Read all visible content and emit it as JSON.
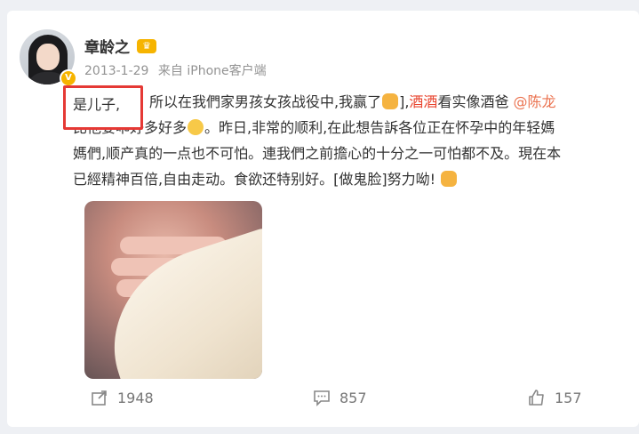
{
  "user": {
    "name": "章龄之",
    "badge_icon": "crown-icon",
    "verified_icon": "verified-v-icon"
  },
  "meta": {
    "date": "2013-1-29",
    "source": "来自 iPhone客户端"
  },
  "post": {
    "highlight": "是儿子,",
    "line1_a": "所以在我們家男孩女孩战役中,我赢了",
    "line1_b": "],",
    "line1_mention_red": "酒酒",
    "line1_c": "看实像酒爸",
    "line1_mention": "@陈龙",
    "line2_a": "比他要乖好多好多",
    "line2_b": "。昨日,非常的顺利,在此想告訴各位正在怀孕中的年轻媽",
    "line3": "媽們,顺产真的一点也不可怕。連我們之前擔心的十分之一可怕都不及。現在本",
    "line4_a": "已經精神百倍,自由走动。食欲还特别好。[做鬼脸]努力呦!"
  },
  "actions": {
    "repost_count": "1948",
    "comment_count": "857",
    "like_count": "157"
  },
  "colors": {
    "highlight_box": "#e53935",
    "mention": "#eb7350",
    "text": "#333333",
    "muted": "#939393"
  }
}
